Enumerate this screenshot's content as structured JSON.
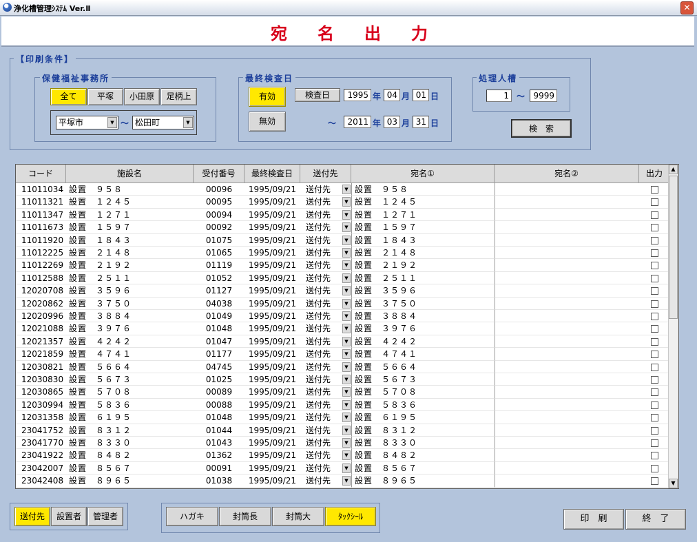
{
  "window": {
    "title": "浄化槽管理ｼｽﾃﾑ Ver.Ⅱ",
    "close": "✕"
  },
  "page_title": "宛名出力",
  "print_conditions": {
    "legend": "【印刷条件】",
    "office": {
      "legend": "保健福祉事務所",
      "buttons": [
        "全て",
        "平塚",
        "小田原",
        "足柄上"
      ],
      "selected": "全て",
      "from": "平塚市",
      "tilde": "～",
      "to": "松田町"
    },
    "last_inspection": {
      "legend": "最終検査日",
      "enabled_label": "有効",
      "disabled_label": "無効",
      "inspection_btn": "検査日",
      "from": {
        "year": "1995",
        "month": "04",
        "day": "01"
      },
      "to": {
        "year": "2011",
        "month": "03",
        "day": "31"
      },
      "year_unit": "年",
      "month_unit": "月",
      "day_unit": "日",
      "tilde": "～"
    },
    "capacity": {
      "legend": "処理人槽",
      "from": "1",
      "tilde": "～",
      "to": "9999"
    },
    "search_label": "検　索"
  },
  "table": {
    "columns": [
      "コード",
      "施設名",
      "受付番号",
      "最終検査日",
      "送付先",
      "宛名①",
      "宛名②",
      "出力"
    ],
    "rows": [
      {
        "code": "11011034",
        "name": "設置　９５８",
        "no": "00096",
        "date": "1995/09/21",
        "dest": "送付先",
        "addr1": "設置　９５８"
      },
      {
        "code": "11011321",
        "name": "設置　１２４５",
        "no": "00095",
        "date": "1995/09/21",
        "dest": "送付先",
        "addr1": "設置　１２４５"
      },
      {
        "code": "11011347",
        "name": "設置　１２７１",
        "no": "00094",
        "date": "1995/09/21",
        "dest": "送付先",
        "addr1": "設置　１２７１"
      },
      {
        "code": "11011673",
        "name": "設置　１５９７",
        "no": "00092",
        "date": "1995/09/21",
        "dest": "送付先",
        "addr1": "設置　１５９７"
      },
      {
        "code": "11011920",
        "name": "設置　１８４３",
        "no": "01075",
        "date": "1995/09/21",
        "dest": "送付先",
        "addr1": "設置　１８４３"
      },
      {
        "code": "11012225",
        "name": "設置　２１４８",
        "no": "01065",
        "date": "1995/09/21",
        "dest": "送付先",
        "addr1": "設置　２１４８"
      },
      {
        "code": "11012269",
        "name": "設置　２１９２",
        "no": "01119",
        "date": "1995/09/21",
        "dest": "送付先",
        "addr1": "設置　２１９２"
      },
      {
        "code": "11012588",
        "name": "設置　２５１１",
        "no": "01052",
        "date": "1995/09/21",
        "dest": "送付先",
        "addr1": "設置　２５１１"
      },
      {
        "code": "12020708",
        "name": "設置　３５９６",
        "no": "01127",
        "date": "1995/09/21",
        "dest": "送付先",
        "addr1": "設置　３５９６"
      },
      {
        "code": "12020862",
        "name": "設置　３７５０",
        "no": "04038",
        "date": "1995/09/21",
        "dest": "送付先",
        "addr1": "設置　３７５０"
      },
      {
        "code": "12020996",
        "name": "設置　３８８４",
        "no": "01049",
        "date": "1995/09/21",
        "dest": "送付先",
        "addr1": "設置　３８８４"
      },
      {
        "code": "12021088",
        "name": "設置　３９７６",
        "no": "01048",
        "date": "1995/09/21",
        "dest": "送付先",
        "addr1": "設置　３９７６"
      },
      {
        "code": "12021357",
        "name": "設置　４２４２",
        "no": "01047",
        "date": "1995/09/21",
        "dest": "送付先",
        "addr1": "設置　４２４２"
      },
      {
        "code": "12021859",
        "name": "設置　４７４１",
        "no": "01177",
        "date": "1995/09/21",
        "dest": "送付先",
        "addr1": "設置　４７４１"
      },
      {
        "code": "12030821",
        "name": "設置　５６６４",
        "no": "04745",
        "date": "1995/09/21",
        "dest": "送付先",
        "addr1": "設置　５６６４"
      },
      {
        "code": "12030830",
        "name": "設置　５６７３",
        "no": "01025",
        "date": "1995/09/21",
        "dest": "送付先",
        "addr1": "設置　５６７３"
      },
      {
        "code": "12030865",
        "name": "設置　５７０８",
        "no": "00089",
        "date": "1995/09/21",
        "dest": "送付先",
        "addr1": "設置　５７０８"
      },
      {
        "code": "12030994",
        "name": "設置　５８３６",
        "no": "00088",
        "date": "1995/09/21",
        "dest": "送付先",
        "addr1": "設置　５８３６"
      },
      {
        "code": "12031358",
        "name": "設置　６１９５",
        "no": "01048",
        "date": "1995/09/21",
        "dest": "送付先",
        "addr1": "設置　６１９５"
      },
      {
        "code": "23041752",
        "name": "設置　８３１２",
        "no": "01044",
        "date": "1995/09/21",
        "dest": "送付先",
        "addr1": "設置　８３１２"
      },
      {
        "code": "23041770",
        "name": "設置　８３３０",
        "no": "01043",
        "date": "1995/09/21",
        "dest": "送付先",
        "addr1": "設置　８３３０"
      },
      {
        "code": "23041922",
        "name": "設置　８４８２",
        "no": "01362",
        "date": "1995/09/21",
        "dest": "送付先",
        "addr1": "設置　８４８２"
      },
      {
        "code": "23042007",
        "name": "設置　８５６７",
        "no": "00091",
        "date": "1995/09/21",
        "dest": "送付先",
        "addr1": "設置　８５６７"
      },
      {
        "code": "23042408",
        "name": "設置　８９６５",
        "no": "01038",
        "date": "1995/09/21",
        "dest": "送付先",
        "addr1": "設置　８９６５"
      }
    ]
  },
  "recipient_buttons": [
    "送付先",
    "設置者",
    "管理者"
  ],
  "recipient_selected": "送付先",
  "format_buttons": [
    "ハガキ",
    "封筒長",
    "封筒大",
    "ﾀｯｸｼｰﾙ"
  ],
  "format_selected": "ﾀｯｸｼｰﾙ",
  "print_label": "印　刷",
  "exit_label": "終　了"
}
